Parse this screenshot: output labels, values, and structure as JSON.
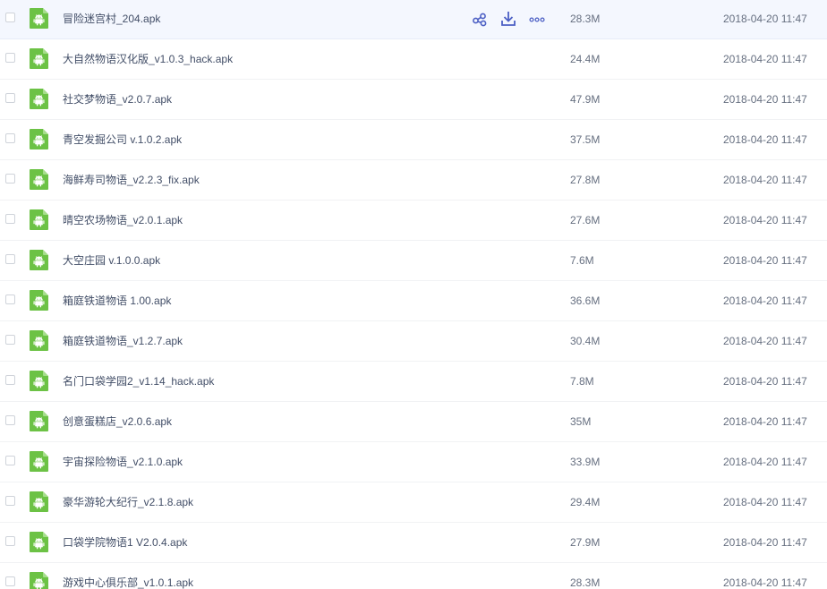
{
  "colors": {
    "file_icon_green": "#6cc245",
    "action_icon": "#4c5fc4",
    "hover_row_bg": "#f4f7fe"
  },
  "row_actions": [
    {
      "icon": "share-icon"
    },
    {
      "icon": "download-icon"
    },
    {
      "icon": "more-icon"
    }
  ],
  "files": [
    {
      "name": "冒险迷宫村_204.apk",
      "size": "28.3M",
      "date": "2018-04-20 11:47",
      "icon": "android-apk-icon",
      "hovered": true
    },
    {
      "name": "大自然物语汉化版_v1.0.3_hack.apk",
      "size": "24.4M",
      "date": "2018-04-20 11:47",
      "icon": "android-apk-icon"
    },
    {
      "name": "社交梦物语_v2.0.7.apk",
      "size": "47.9M",
      "date": "2018-04-20 11:47",
      "icon": "android-apk-icon"
    },
    {
      "name": "青空发掘公司 v.1.0.2.apk",
      "size": "37.5M",
      "date": "2018-04-20 11:47",
      "icon": "android-apk-icon"
    },
    {
      "name": "海鲜寿司物语_v2.2.3_fix.apk",
      "size": "27.8M",
      "date": "2018-04-20 11:47",
      "icon": "android-apk-icon"
    },
    {
      "name": "晴空农场物语_v2.0.1.apk",
      "size": "27.6M",
      "date": "2018-04-20 11:47",
      "icon": "android-apk-icon"
    },
    {
      "name": "大空庄园 v.1.0.0.apk",
      "size": "7.6M",
      "date": "2018-04-20 11:47",
      "icon": "android-apk-icon"
    },
    {
      "name": "箱庭铁道物语 1.00.apk",
      "size": "36.6M",
      "date": "2018-04-20 11:47",
      "icon": "android-apk-icon"
    },
    {
      "name": "箱庭铁道物语_v1.2.7.apk",
      "size": "30.4M",
      "date": "2018-04-20 11:47",
      "icon": "android-apk-icon"
    },
    {
      "name": "名门口袋学园2_v1.14_hack.apk",
      "size": "7.8M",
      "date": "2018-04-20 11:47",
      "icon": "android-apk-icon"
    },
    {
      "name": "创意蛋糕店_v2.0.6.apk",
      "size": "35M",
      "date": "2018-04-20 11:47",
      "icon": "android-apk-icon"
    },
    {
      "name": "宇宙探险物语_v2.1.0.apk",
      "size": "33.9M",
      "date": "2018-04-20 11:47",
      "icon": "android-apk-icon"
    },
    {
      "name": "豪华游轮大纪行_v2.1.8.apk",
      "size": "29.4M",
      "date": "2018-04-20 11:47",
      "icon": "android-apk-icon"
    },
    {
      "name": "口袋学院物语1 V2.0.4.apk",
      "size": "27.9M",
      "date": "2018-04-20 11:47",
      "icon": "android-apk-icon"
    },
    {
      "name": "游戏中心俱乐部_v1.0.1.apk",
      "size": "28.3M",
      "date": "2018-04-20 11:47",
      "icon": "android-apk-icon"
    }
  ]
}
